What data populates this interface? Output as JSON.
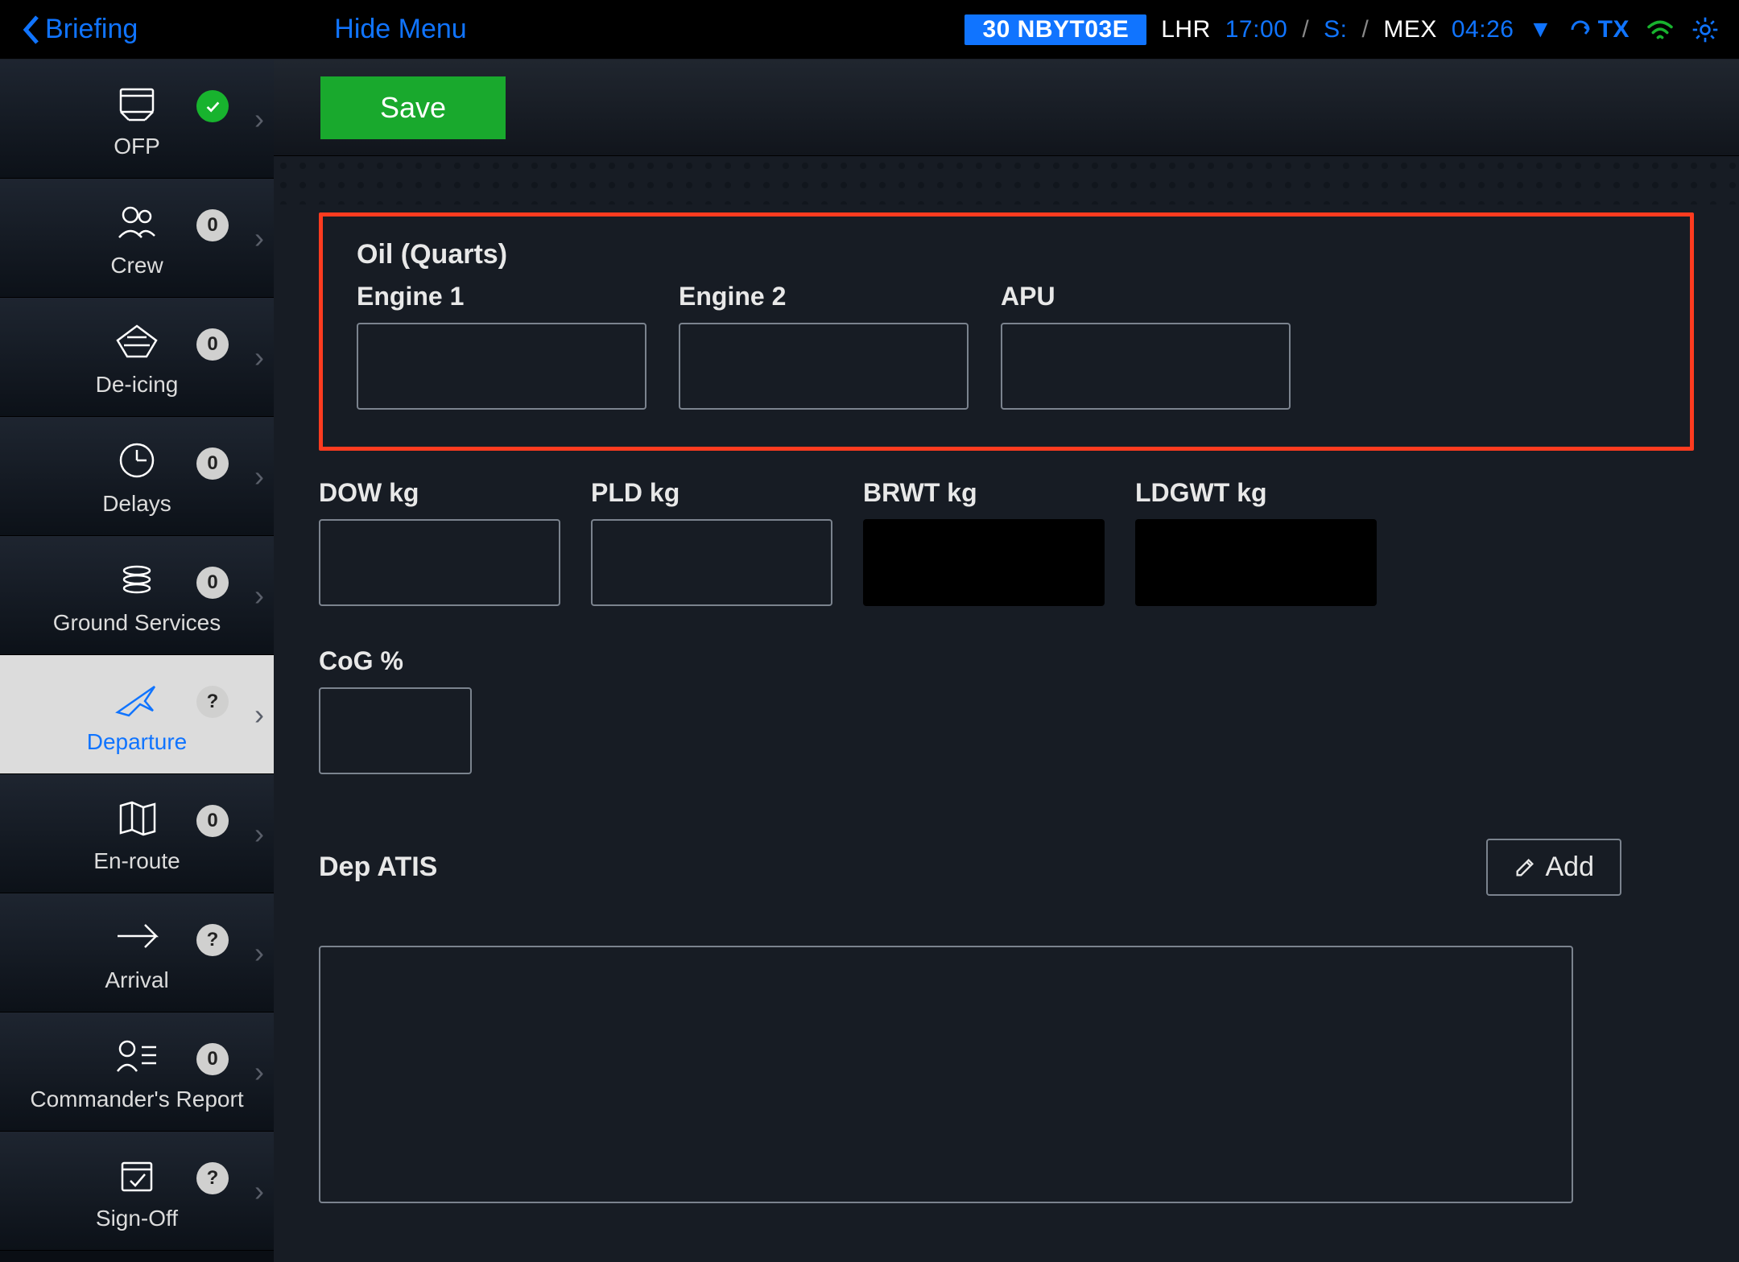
{
  "topbar": {
    "back_label": "Briefing",
    "hide_menu_label": "Hide Menu",
    "flight_code": "30 NBYT03E",
    "dep_airport": "LHR",
    "dep_time": "17:00",
    "dep_suffix": "S:",
    "arr_airport": "MEX",
    "arr_time": "04:26",
    "tx_label": "TX"
  },
  "sidebar": {
    "items": [
      {
        "label": "OFP",
        "badge_kind": "check"
      },
      {
        "label": "Crew",
        "badge": "0"
      },
      {
        "label": "De-icing",
        "badge": "0"
      },
      {
        "label": "Delays",
        "badge": "0"
      },
      {
        "label": "Ground Services",
        "badge": "0"
      },
      {
        "label": "Departure",
        "badge": "?"
      },
      {
        "label": "En-route",
        "badge": "0"
      },
      {
        "label": "Arrival",
        "badge": "?"
      },
      {
        "label": "Commander's Report",
        "badge": "0"
      },
      {
        "label": "Sign-Off",
        "badge": "?"
      }
    ]
  },
  "main": {
    "save_label": "Save",
    "oil": {
      "title": "Oil (Quarts)",
      "engine1_label": "Engine 1",
      "engine2_label": "Engine 2",
      "apu_label": "APU",
      "engine1_value": "",
      "engine2_value": "",
      "apu_value": ""
    },
    "weights": {
      "dow_label": "DOW kg",
      "pld_label": "PLD kg",
      "brwt_label": "BRWT kg",
      "ldgwt_label": "LDGWT kg",
      "dow_value": "",
      "pld_value": "",
      "brwt_value": "",
      "ldgwt_value": ""
    },
    "cog": {
      "label": "CoG %",
      "value": ""
    },
    "atis": {
      "title": "Dep ATIS",
      "add_label": "Add",
      "content": ""
    }
  }
}
